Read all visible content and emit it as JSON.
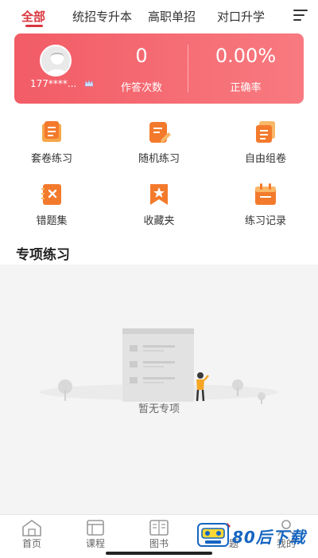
{
  "tabs": [
    {
      "label": "全部",
      "active": true
    },
    {
      "label": "统招专升本"
    },
    {
      "label": "高职单招"
    },
    {
      "label": "对口升学"
    }
  ],
  "icons": {
    "menu": "hamburger-icon"
  },
  "stats": {
    "phone": "177****...",
    "answer_count": "0",
    "answer_count_label": "作答次数",
    "accuracy": "0.00%",
    "accuracy_label": "正确率"
  },
  "grid": [
    {
      "label": "套卷练习",
      "icon": "paper-set-icon"
    },
    {
      "label": "随机练习",
      "icon": "random-practice-icon"
    },
    {
      "label": "自由组卷",
      "icon": "custom-paper-icon"
    },
    {
      "label": "错题集",
      "icon": "wrong-questions-icon"
    },
    {
      "label": "收藏夹",
      "icon": "favorites-icon"
    },
    {
      "label": "练习记录",
      "icon": "practice-record-icon"
    }
  ],
  "section": {
    "title": "专项练习"
  },
  "empty": {
    "text": "暂无专项"
  },
  "bottom_nav": [
    {
      "label": "首页"
    },
    {
      "label": "课程"
    },
    {
      "label": "图书"
    },
    {
      "label": "题"
    },
    {
      "label": "我的"
    }
  ],
  "watermark": {
    "text": "80后下载"
  },
  "colors": {
    "accent": "#d9363e",
    "card_start": "#f25c66",
    "card_end": "#f87a80",
    "icon_orange": "#f37a2c"
  }
}
